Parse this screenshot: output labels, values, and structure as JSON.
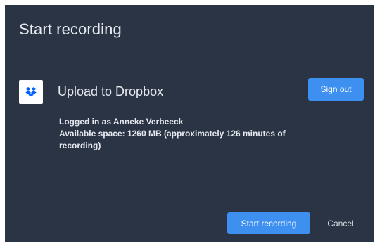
{
  "dialog": {
    "title": "Start recording",
    "background_color": "#2b3444"
  },
  "provider": {
    "icon": "dropbox-icon",
    "name": "Upload to Dropbox",
    "sign_out_label": "Sign out",
    "logged_in_text": "Logged in as Anneke Verbeeck",
    "available_space_text": "Available space: 1260 MB (approximately 126 minutes of recording)"
  },
  "footer": {
    "start_label": "Start recording",
    "cancel_label": "Cancel"
  },
  "colors": {
    "accent": "#3d8ff0",
    "dropbox_blue": "#0061fe"
  }
}
